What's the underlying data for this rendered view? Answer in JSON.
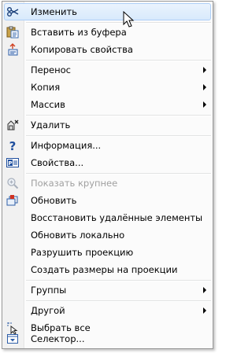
{
  "menu": {
    "items": [
      {
        "label": "Изменить",
        "icon": "scissors-edit-icon",
        "highlighted": true
      },
      {
        "label": "Вставить из буфера",
        "icon": "paste-clipboard-icon"
      },
      {
        "label": "Копировать свойства",
        "icon": "copy-properties-icon"
      },
      {
        "label": "Перенос",
        "submenu": true
      },
      {
        "label": "Копия",
        "submenu": true
      },
      {
        "label": "Массив",
        "submenu": true
      },
      {
        "label": "Удалить",
        "icon": "delete-icon"
      },
      {
        "label": "Информация...",
        "icon": "question-icon"
      },
      {
        "label": "Свойства...",
        "icon": "properties-icon"
      },
      {
        "label": "Показать крупнее",
        "icon": "zoom-in-icon",
        "disabled": true
      },
      {
        "label": "Обновить"
      },
      {
        "label": "Восстановить удалённые элементы"
      },
      {
        "label": "Обновить локально"
      },
      {
        "label": "Разрушить проекцию"
      },
      {
        "label": "Создать размеры на проекции"
      },
      {
        "label": "Группы",
        "submenu": true
      },
      {
        "label": "Другой",
        "submenu": true
      },
      {
        "label": "Выбрать все",
        "icon": "select-all-icon"
      },
      {
        "label": "Селектор...",
        "icon": "selector-icon"
      }
    ]
  },
  "colors": {
    "highlight_border": "#aecff7",
    "disabled_text": "#a0a0a0",
    "gutter": "#f1f1f1"
  }
}
